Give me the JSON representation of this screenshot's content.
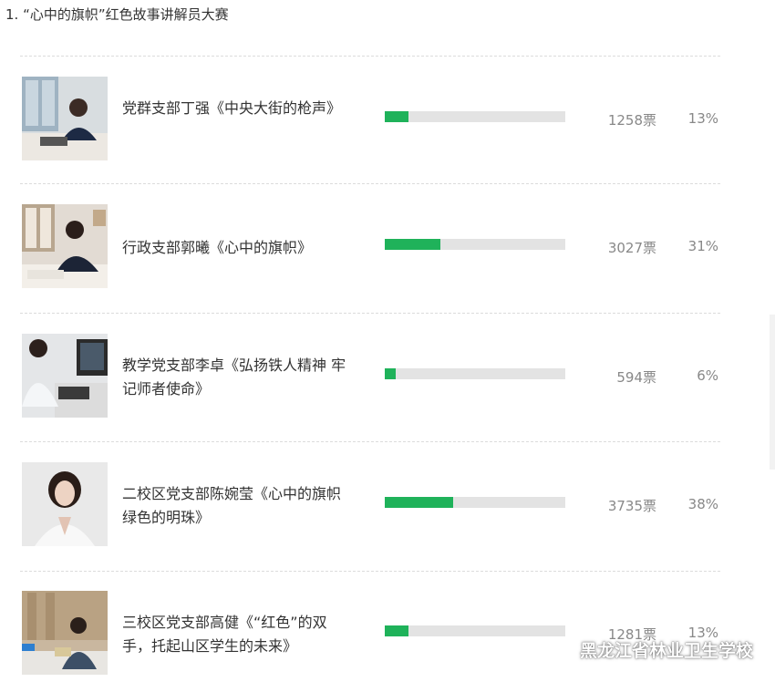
{
  "title": "1. “心中的旗帜”红色故事讲解员大赛",
  "colors": {
    "bar_fill": "#1fb25a",
    "bar_track": "#e3e3e3"
  },
  "candidates": [
    {
      "name": "党群支部丁强《中央大街的枪声》",
      "votes": "1258票",
      "percent": "13%",
      "fraction": 0.13
    },
    {
      "name": "行政支部郭曦《心中的旗帜》",
      "votes": "3027票",
      "percent": "31%",
      "fraction": 0.31
    },
    {
      "name": "教学党支部李卓《弘扬铁人精神 牢记师者使命》",
      "votes": "594票",
      "percent": "6%",
      "fraction": 0.06
    },
    {
      "name": "二校区党支部陈婉莹《心中的旗帜 绿色的明珠》",
      "votes": "3735票",
      "percent": "38%",
      "fraction": 0.38
    },
    {
      "name": "三校区党支部高健《“红色”的双手，托起山区学生的未来》",
      "votes": "1281票",
      "percent": "13%",
      "fraction": 0.13
    }
  ],
  "watermark": {
    "icon": "wechat-icon",
    "text": "黑龙江省林业卫生学校"
  }
}
